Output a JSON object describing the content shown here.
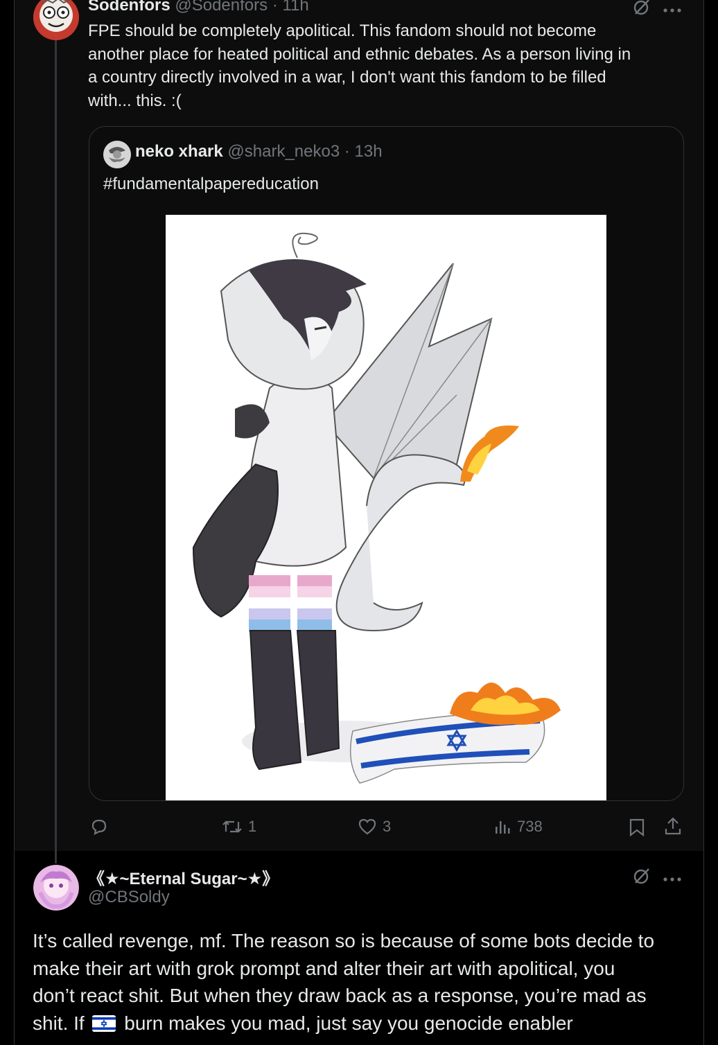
{
  "tweet1": {
    "author_name": "Sodenfors",
    "author_handle": "@Sodenfors",
    "time": "11h",
    "separator": "·",
    "body_lines": [
      "FPE should be completely apolitical. This fandom should not become",
      "another place for heated political and ethnic debates. As a person living in",
      "a country directly involved in a war, I don't want this fandom to be filled",
      "with... this. :("
    ],
    "quote": {
      "author_name": "neko xhark",
      "author_handle": "@shark_neko3",
      "time": "13h",
      "text": "#fundamentalpapereducation"
    },
    "actions": {
      "reply_count": "",
      "retweet_count": "1",
      "like_count": "3",
      "view_count": "738"
    }
  },
  "tweet2": {
    "author_name": "《★~Eternal Sugar~★》",
    "author_handle": "@CBSoldy",
    "body_lines": [
      "It’s called revenge, mf. The reason so is because of some bots decide to",
      "make their art with grok prompt and alter their art with apolitical, you",
      "don’t react shit. But when they draw back as a response, you’re mad as"
    ],
    "last_line_before": "shit. If",
    "last_line_after": "burn makes you mad, just say you genocide enabler"
  },
  "icons": [
    "grok-icon",
    "more-icon",
    "reply-icon",
    "retweet-icon",
    "like-icon",
    "views-icon",
    "bookmark-icon",
    "share-icon",
    "israel-flag-emoji"
  ],
  "colors": {
    "background": "#000000",
    "tweet_bg": "#0d0d0d",
    "text_primary": "#e7e9ea",
    "text_secondary": "#71767b",
    "border": "#2f3336",
    "flag_blue": "#0038b8"
  }
}
